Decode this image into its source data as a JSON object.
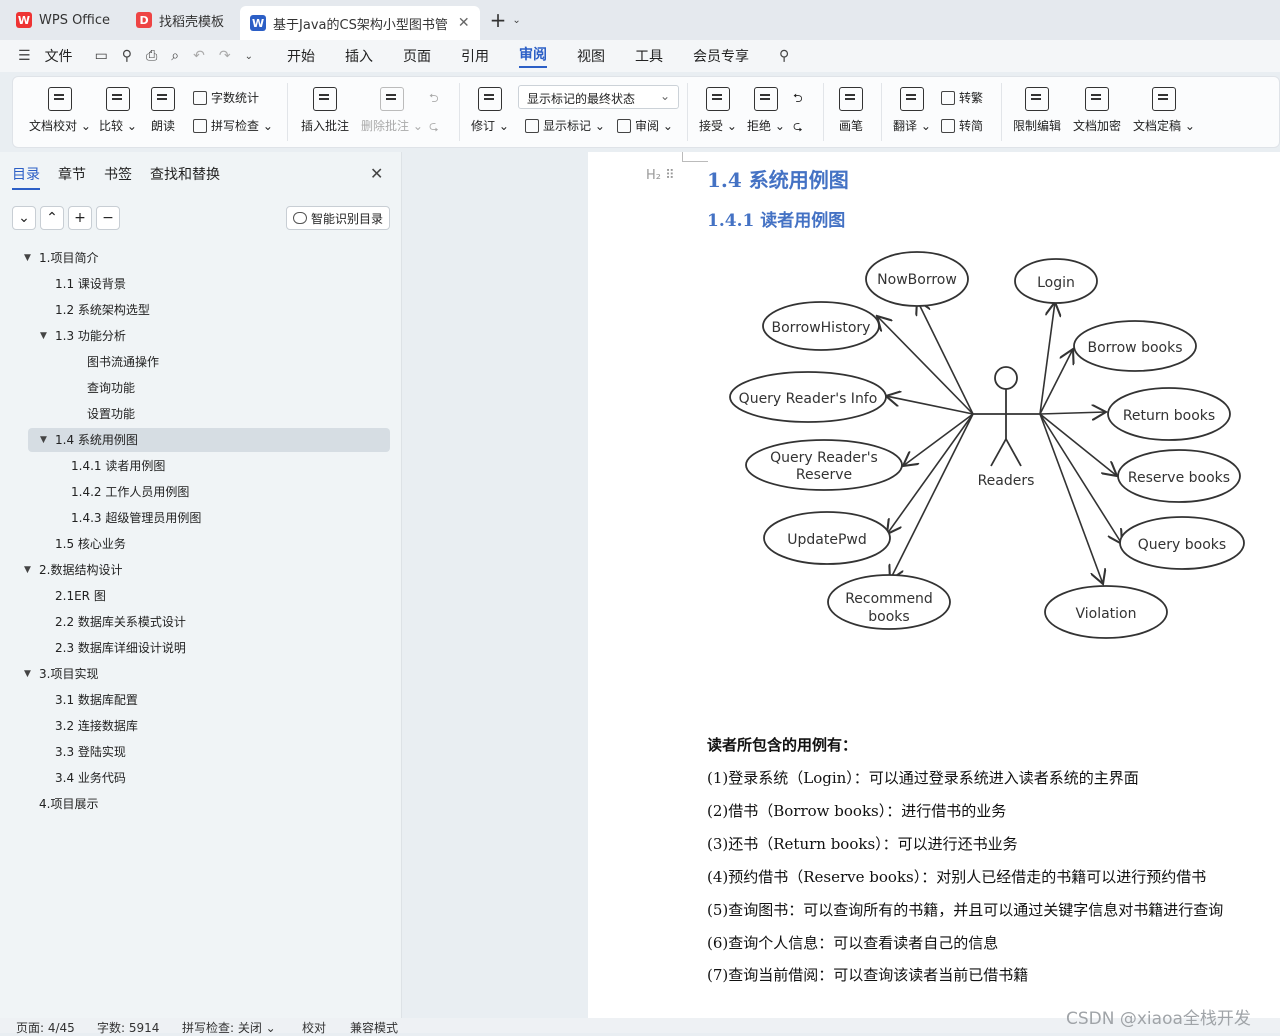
{
  "tabs": [
    {
      "label": "WPS Office",
      "icon": "wps-logo-icon"
    },
    {
      "label": "找稻壳模板",
      "icon": "docer-icon"
    },
    {
      "label": "基于Java的CS架构小型图书管",
      "icon": "word-doc-icon"
    }
  ],
  "menu": {
    "file": "文件",
    "items": [
      "开始",
      "插入",
      "页面",
      "引用",
      "审阅",
      "视图",
      "工具",
      "会员专享"
    ],
    "active": "审阅"
  },
  "ribbon": {
    "proofread": "文档校对",
    "compare": "比较",
    "read_aloud": "朗读",
    "word_count": "字数统计",
    "spell_check": "拼写检查",
    "insert_comment": "插入批注",
    "delete_comment": "删除批注",
    "track": "修订",
    "markup_select": "显示标记的最终状态",
    "show_markup": "显示标记",
    "review": "审阅",
    "accept": "接受",
    "reject": "拒绝",
    "pen": "画笔",
    "translate": "翻译",
    "to_traditional": "转繁",
    "to_simplified": "转简",
    "restrict_edit": "限制编辑",
    "encrypt": "文档加密",
    "finalize": "文档定稿"
  },
  "sidebar": {
    "tabs": [
      "目录",
      "章节",
      "书签",
      "查找和替换"
    ],
    "smart_btn": "智能识别目录",
    "toc": [
      {
        "label": "1.项目简介",
        "level": 0,
        "expand": true
      },
      {
        "label": "1.1 课设背景",
        "level": 1
      },
      {
        "label": "1.2 系统架构选型",
        "level": 1
      },
      {
        "label": "1.3 功能分析",
        "level": 1,
        "expand": true
      },
      {
        "label": "图书流通操作",
        "level": 3
      },
      {
        "label": "查询功能",
        "level": 3
      },
      {
        "label": "设置功能",
        "level": 3
      },
      {
        "label": "1.4 系统用例图",
        "level": 1,
        "expand": true,
        "selected": true
      },
      {
        "label": "1.4.1 读者用例图",
        "level": 2
      },
      {
        "label": "1.4.2 工作人员用例图",
        "level": 2
      },
      {
        "label": "1.4.3 超级管理员用例图",
        "level": 2
      },
      {
        "label": "1.5 核心业务",
        "level": 1
      },
      {
        "label": "2.数据结构设计",
        "level": 0,
        "expand": true
      },
      {
        "label": "2.1ER 图",
        "level": 1
      },
      {
        "label": "2.2 数据库关系模式设计",
        "level": 1
      },
      {
        "label": "2.3 数据库详细设计说明",
        "level": 1
      },
      {
        "label": "3.项目实现",
        "level": 0,
        "expand": true
      },
      {
        "label": "3.1 数据库配置",
        "level": 1
      },
      {
        "label": "3.2 连接数据库",
        "level": 1
      },
      {
        "label": "3.3 登陆实现",
        "level": 1
      },
      {
        "label": "3.4 业务代码",
        "level": 1
      },
      {
        "label": "4.项目展示",
        "level": 0
      }
    ]
  },
  "doc": {
    "h2_tag": "H₂",
    "h2": "1.4 系统用例图",
    "h3": "1.4.1 读者用例图",
    "actor": "Readers",
    "use_cases": [
      "NowBorrow",
      "Login",
      "BorrowHistory",
      "Borrow books",
      "Query Reader's Info",
      "Return books",
      "Query Reader's",
      "Reserve",
      "Reserve books",
      "UpdatePwd",
      "Query books",
      "Recommend",
      "books",
      "Violation"
    ],
    "intro": "读者所包含的用例有：",
    "items": [
      "(1)登录系统（Login）：可以通过登录系统进入读者系统的主界面",
      "(2)借书（Borrow books）：进行借书的业务",
      "(3)还书（Return books）：可以进行还书业务",
      "(4)预约借书（Reserve books）：对别人已经借走的书籍可以进行预约借书",
      "(5)查询图书：可以查询所有的书籍，并且可以通过关键字信息对书籍进行查询",
      "(6)查询个人信息：可以查看读者自己的信息",
      "(7)查询当前借阅：可以查询该读者当前已借书籍"
    ]
  },
  "status": {
    "page": "页面: 4/45",
    "words": "字数: 5914",
    "spell": "拼写检查: 关闭",
    "proof": "校对",
    "compat": "兼容模式"
  },
  "watermark": "CSDN @xiaoa全栈开发",
  "colors": {
    "accent": "#2c5fc6",
    "heading": "#4472c4"
  }
}
